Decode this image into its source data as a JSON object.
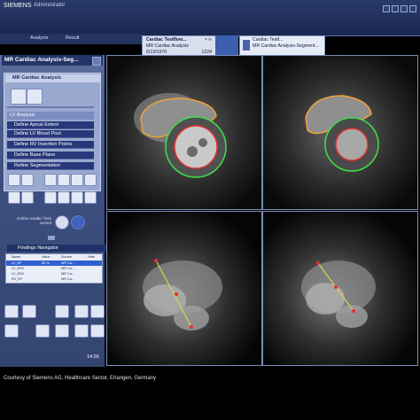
{
  "header": {
    "brand": "SIEMENS",
    "user": "Administrator",
    "tabs": [
      {
        "label": "Analysis"
      },
      {
        "label": "Result"
      }
    ],
    "patient": {
      "name": "Cardiac Testflow...",
      "study": "MR Cardiac Analysis",
      "date": "6/13/1976",
      "number": "1224",
      "close": "× ∞"
    },
    "study": {
      "name": "Cardiac Testf...",
      "study": "MR Cardiac Analysis-Segment...",
      "date": ""
    }
  },
  "left_panel": {
    "title": "MR Cardiac Analysis-Seg...",
    "subtitle": "MR Cardiac Analysis",
    "lv_header": "LV Analysis",
    "menu": [
      {
        "label": "Define Apical Extent"
      },
      {
        "label": "Define LV Blood Pool"
      },
      {
        "label": "Define RV Insertion Points"
      },
      {
        "label": "Define Base Plane"
      },
      {
        "label": "Refine Segmentation"
      }
    ],
    "archive_label": "Archive results / from current",
    "findings_title": "Findings Navigator",
    "findings_columns": [
      "Name",
      "Value",
      "Source",
      "Hide"
    ],
    "findings_rows": [
      {
        "name": "LV_EF",
        "value": "55 %",
        "source": "MR Ca..."
      },
      {
        "name": "LV_ESV",
        "value": "",
        "source": "MR Ca..."
      },
      {
        "name": "LV_EDV",
        "value": "",
        "source": "MR Ca..."
      },
      {
        "name": "RV_EF",
        "value": "",
        "source": "MR Ca..."
      }
    ],
    "clock": "14:26"
  },
  "viewports": [
    {
      "label": "short-axis"
    },
    {
      "label": "short-axis"
    },
    {
      "label": "long-axis"
    },
    {
      "label": "long-axis"
    }
  ],
  "footer": {
    "credit": "Courtesy of Siemens AG, Healthcare Sector, Erlangen, Germany"
  },
  "colors": {
    "accent": "#2f5fd1",
    "panel": "#3d4f80",
    "contour_epi": "#3fe04a",
    "contour_endo": "#e03232",
    "contour_rv": "#f0a23c",
    "longaxis_line": "#d8d64a"
  }
}
